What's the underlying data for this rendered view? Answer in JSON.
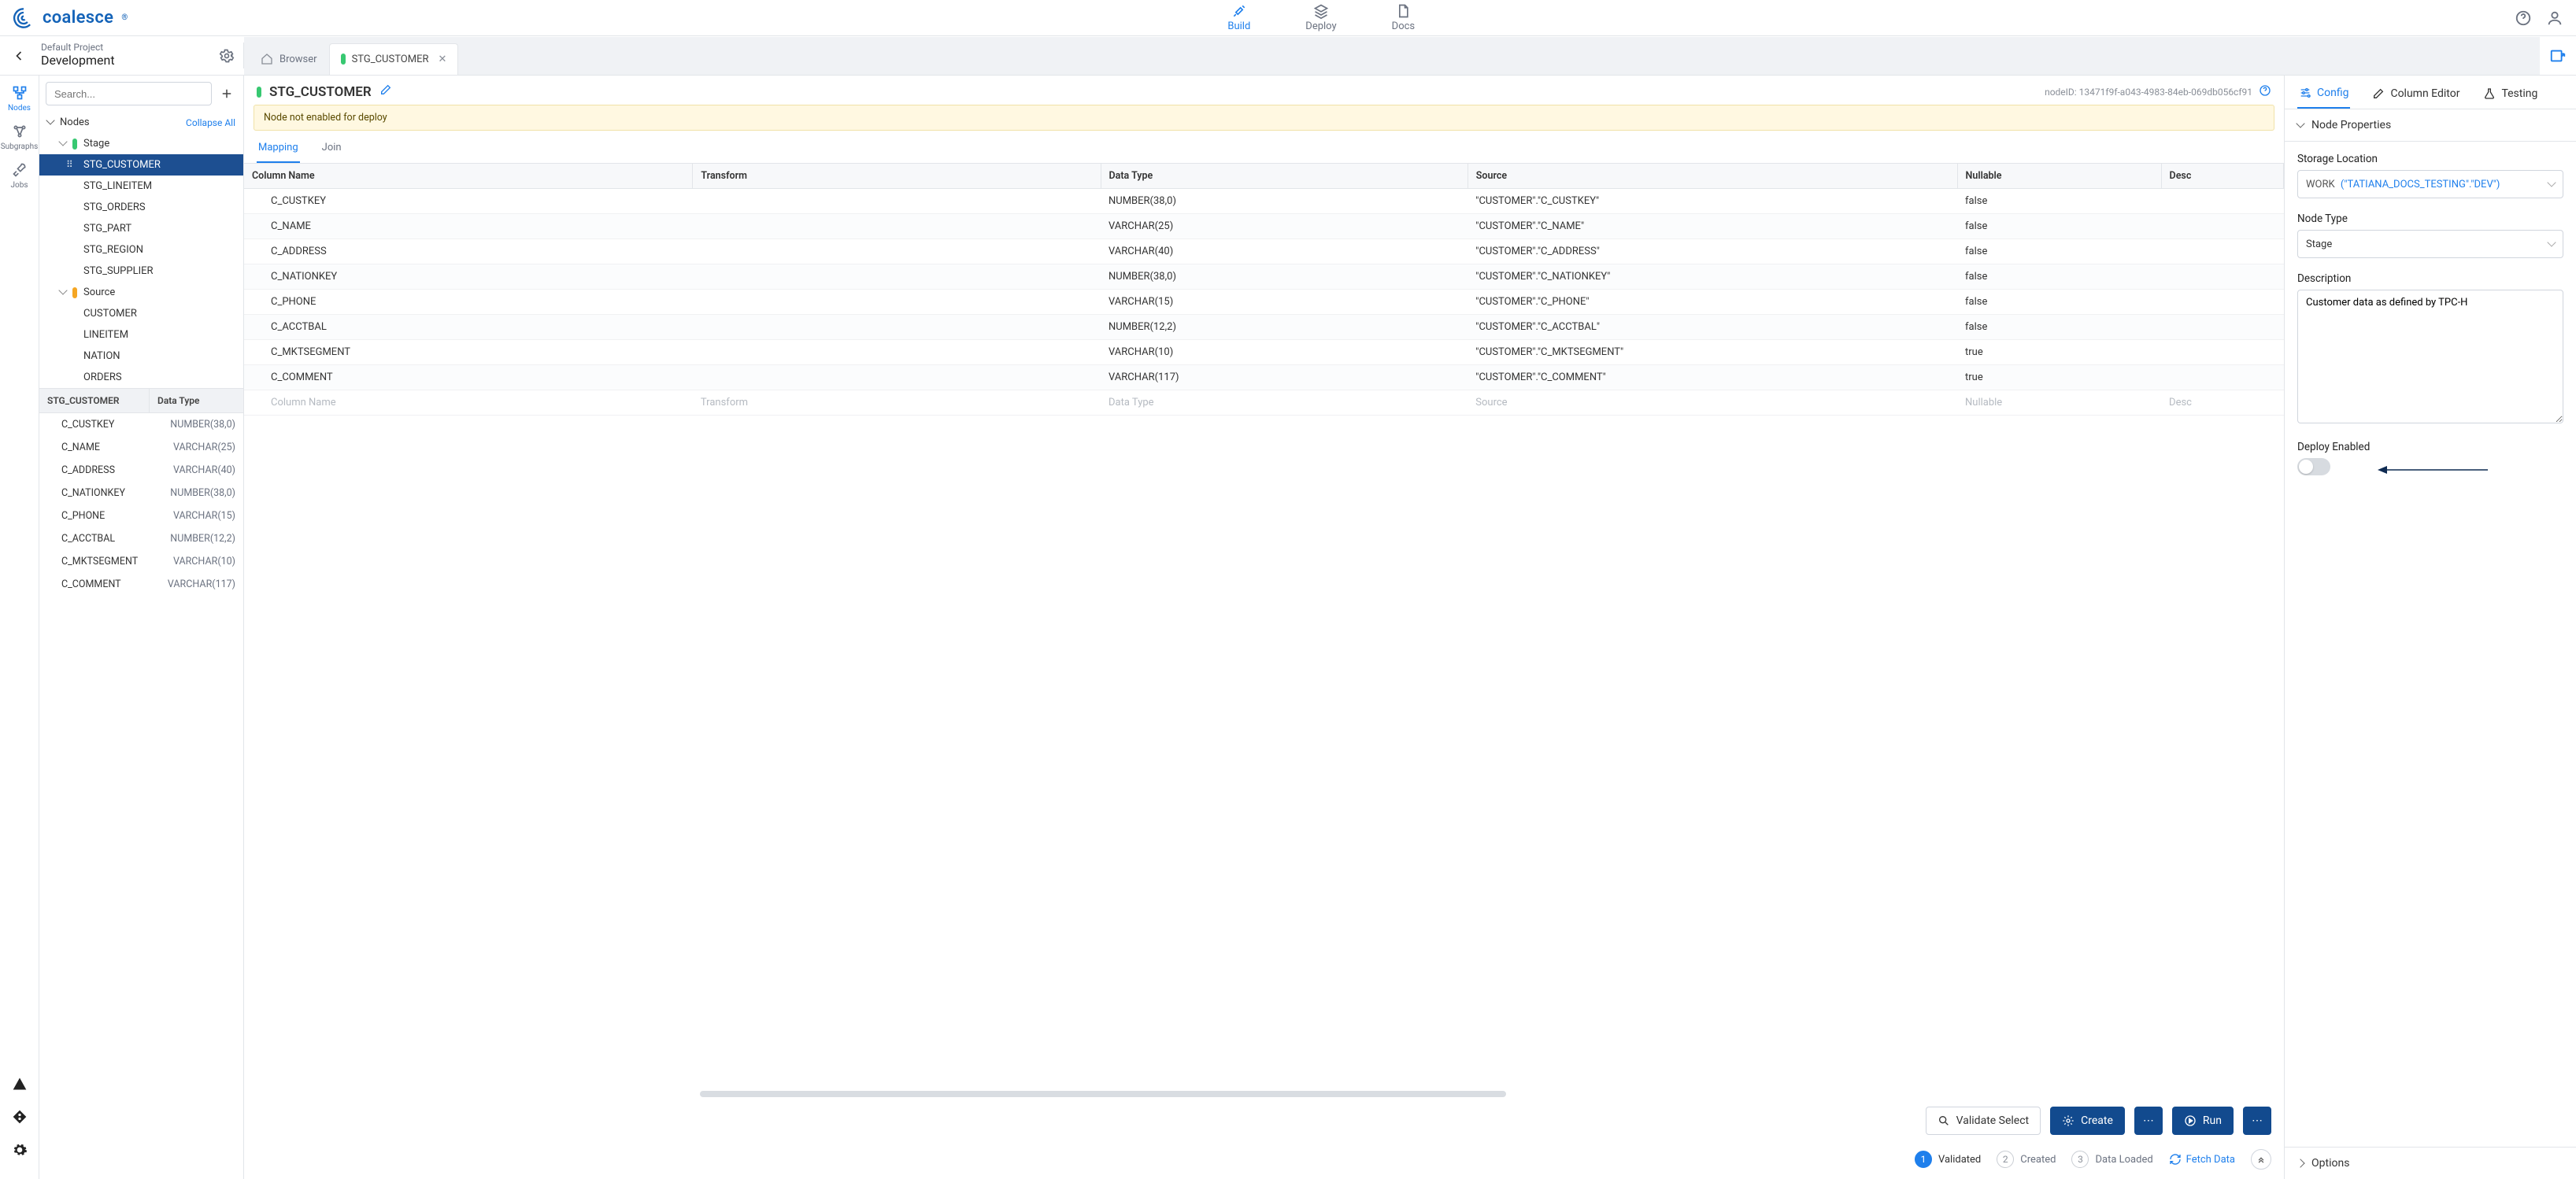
{
  "brand": "coalesce",
  "topnav": {
    "build": "Build",
    "deploy": "Deploy",
    "docs": "Docs"
  },
  "project": {
    "default_label": "Default Project",
    "name": "Development"
  },
  "browser_tab": "Browser",
  "active_tab": "STG_CUSTOMER",
  "search_placeholder": "Search...",
  "sidebar_rail": {
    "nodes": "Nodes",
    "subgraphs": "Subgraphs",
    "jobs": "Jobs"
  },
  "nodes_section": {
    "title": "Nodes",
    "collapse_all": "Collapse All"
  },
  "tree": {
    "stage": {
      "label": "Stage",
      "children": [
        "STG_CUSTOMER",
        "STG_LINEITEM",
        "STG_ORDERS",
        "STG_PART",
        "STG_REGION",
        "STG_SUPPLIER"
      ]
    },
    "source": {
      "label": "Source",
      "children": [
        "CUSTOMER",
        "LINEITEM",
        "NATION",
        "ORDERS"
      ]
    }
  },
  "lower_panel": {
    "name_header": "STG_CUSTOMER",
    "type_header": "Data Type",
    "rows": [
      {
        "n": "C_CUSTKEY",
        "t": "NUMBER(38,0)"
      },
      {
        "n": "C_NAME",
        "t": "VARCHAR(25)"
      },
      {
        "n": "C_ADDRESS",
        "t": "VARCHAR(40)"
      },
      {
        "n": "C_NATIONKEY",
        "t": "NUMBER(38,0)"
      },
      {
        "n": "C_PHONE",
        "t": "VARCHAR(15)"
      },
      {
        "n": "C_ACCTBAL",
        "t": "NUMBER(12,2)"
      },
      {
        "n": "C_MKTSEGMENT",
        "t": "VARCHAR(10)"
      },
      {
        "n": "C_COMMENT",
        "t": "VARCHAR(117)"
      }
    ]
  },
  "node": {
    "title": "STG_CUSTOMER",
    "id_label": "nodeID: 13471f9f-a043-4983-84eb-069db056cf91",
    "warn": "Node not enabled for deploy",
    "tabs": {
      "mapping": "Mapping",
      "join": "Join"
    },
    "columns": {
      "name": "Column Name",
      "transform": "Transform",
      "datatype": "Data Type",
      "source": "Source",
      "nullable": "Nullable",
      "desc": "Desc"
    },
    "rows": [
      {
        "name": "C_CUSTKEY",
        "transform": "",
        "datatype": "NUMBER(38,0)",
        "source": "\"CUSTOMER\".\"C_CUSTKEY\"",
        "nullable": "false"
      },
      {
        "name": "C_NAME",
        "transform": "",
        "datatype": "VARCHAR(25)",
        "source": "\"CUSTOMER\".\"C_NAME\"",
        "nullable": "false"
      },
      {
        "name": "C_ADDRESS",
        "transform": "",
        "datatype": "VARCHAR(40)",
        "source": "\"CUSTOMER\".\"C_ADDRESS\"",
        "nullable": "false"
      },
      {
        "name": "C_NATIONKEY",
        "transform": "",
        "datatype": "NUMBER(38,0)",
        "source": "\"CUSTOMER\".\"C_NATIONKEY\"",
        "nullable": "false"
      },
      {
        "name": "C_PHONE",
        "transform": "",
        "datatype": "VARCHAR(15)",
        "source": "\"CUSTOMER\".\"C_PHONE\"",
        "nullable": "false"
      },
      {
        "name": "C_ACCTBAL",
        "transform": "",
        "datatype": "NUMBER(12,2)",
        "source": "\"CUSTOMER\".\"C_ACCTBAL\"",
        "nullable": "false"
      },
      {
        "name": "C_MKTSEGMENT",
        "transform": "",
        "datatype": "VARCHAR(10)",
        "source": "\"CUSTOMER\".\"C_MKTSEGMENT\"",
        "nullable": "true"
      },
      {
        "name": "C_COMMENT",
        "transform": "",
        "datatype": "VARCHAR(117)",
        "source": "\"CUSTOMER\".\"C_COMMENT\"",
        "nullable": "true"
      }
    ],
    "ghost": {
      "name": "Column Name",
      "transform": "Transform",
      "datatype": "Data Type",
      "source": "Source",
      "nullable": "Nullable",
      "desc": "Desc"
    }
  },
  "actions": {
    "validate": "Validate Select",
    "create": "Create",
    "run": "Run"
  },
  "status": {
    "s1": "Validated",
    "s2": "Created",
    "s3": "Data Loaded",
    "fetch": "Fetch Data"
  },
  "right": {
    "tabs": {
      "config": "Config",
      "column": "Column Editor",
      "testing": "Testing"
    },
    "node_props": "Node Properties",
    "storage_label": "Storage Location",
    "storage_work": "WORK",
    "storage_rest": "(\"TATIANA_DOCS_TESTING\".\"DEV\")",
    "node_type_label": "Node Type",
    "node_type_value": "Stage",
    "desc_label": "Description",
    "desc_value": "Customer data as defined by TPC-H",
    "deploy_label": "Deploy Enabled",
    "options": "Options"
  }
}
